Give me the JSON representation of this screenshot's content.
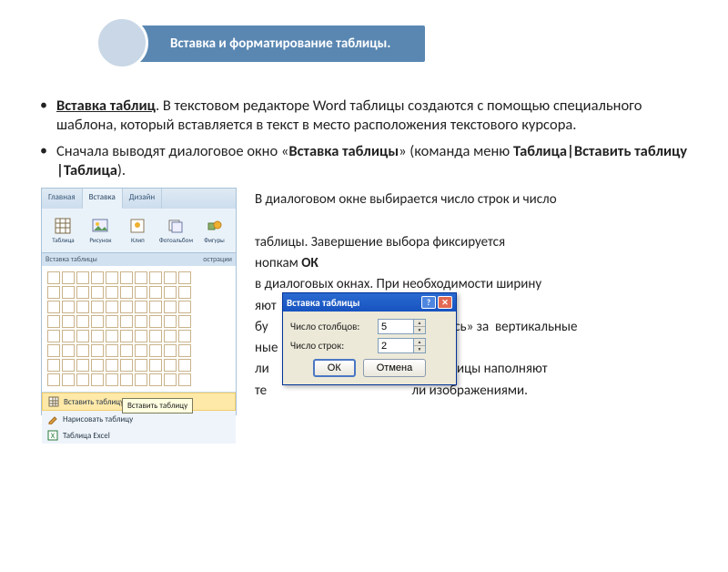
{
  "header": {
    "title": "Вставка и форматирование таблицы."
  },
  "bullets": {
    "b1_lead": "Вставка таблиц",
    "b1_rest": ".  В текстовом редакторе Word таблицы создаются с помощью специального шаблона, который вставляется в текст в место расположения текстового курсора.",
    "b2_a": "Сначала выводят диалоговое окно «",
    "b2_bold1": "Вставка таблицы",
    "b2_b": "» (команда меню ",
    "b2_bold2": "Таблица|Вставить таблицу |Таблица",
    "b2_c": ")."
  },
  "ribbon": {
    "tabs": {
      "home": "Главная",
      "insert": "Вставка",
      "design": "Дизайн"
    },
    "tools": {
      "table": "Таблица",
      "picture": "Рисунок",
      "clip": "Клип",
      "album": "Фотоальбом",
      "shapes": "Фигуры"
    },
    "group_label_left": "Вставка таблицы",
    "group_label_right": "острации",
    "menu": {
      "insert_table": "Вставить таблицу...",
      "draw_table": "Нарисовать таблицу",
      "excel_table": "Таблица Excel"
    },
    "tooltip": "Вставить таблицу"
  },
  "rtext": {
    "l1": "В диалоговом окне выбирается число строк и число",
    "l2": "таблицы.   Завершение выбора фиксируется",
    "l3a": "нопкам ",
    "l3_bold": "ОК",
    "l4": "в диалоговых окнах.  При необходимости ширину",
    "l5": "яют",
    "l6": "бу                                               цепляясь» за  вертикальные",
    "l7": "ные",
    "l8": "ли                                               ки таблицы наполняют",
    "l9": "те                                               ли изображениями."
  },
  "dialog": {
    "title": "Вставка таблицы",
    "cols_label": "Число столбцов:",
    "rows_label": "Число строк:",
    "cols_value": "5",
    "rows_value": "2",
    "ok": "ОК",
    "cancel": "Отмена"
  }
}
